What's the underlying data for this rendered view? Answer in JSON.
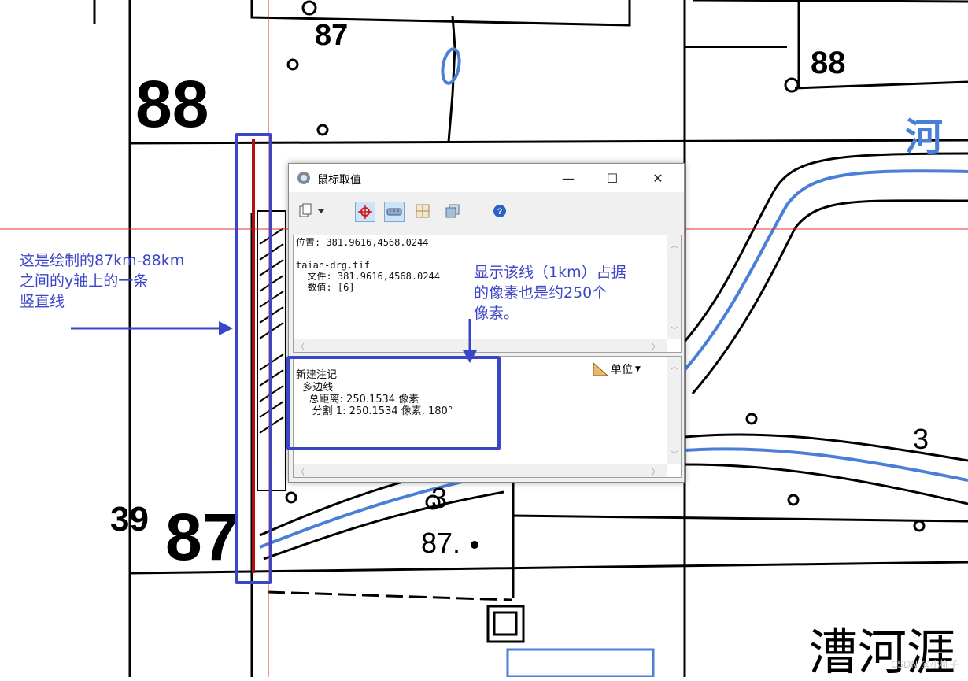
{
  "map": {
    "grid_label_88_left": "88",
    "grid_label_87_top": "87",
    "grid_label_88_right": "88",
    "grid_label_3987": "3987",
    "grid_label_39_prefix": "39",
    "grid_label_87_big": "87",
    "spot_label_87": "87.",
    "spot_label_3a": "3",
    "spot_label_3b": "3",
    "place_name": "漕河涯",
    "river_label": "河"
  },
  "annotations": {
    "left_note_lines": [
      "这是绘制的87km-88km",
      "之间的y轴上的一条",
      "竖直线"
    ],
    "right_note_lines": [
      "显示该线（1km）占据",
      "的像素也是约250个",
      "像素。"
    ]
  },
  "dialog": {
    "title": "鼠标取值",
    "buttons": {
      "minimize": "—",
      "maximize": "☐",
      "close": "✕"
    },
    "info": {
      "position": "位置: 381.9616,4568.0244",
      "filename": "taian-drg.tif",
      "file_line": "  文件: 381.9616,4568.0244",
      "value_line": "  数值: [6]"
    },
    "measure": {
      "unit_label": "单位",
      "title": "新建注记",
      "line1": "  多边线",
      "line2": "    总距离: 250.1534 像素",
      "line3": "     分割 1: 250.1534 像素, 180°"
    }
  },
  "watermark": "CSDN @小柳子",
  "colors": {
    "annotation_blue": "#3a46c8",
    "red_line": "#e23030",
    "map_blue": "#4a7fd8"
  }
}
